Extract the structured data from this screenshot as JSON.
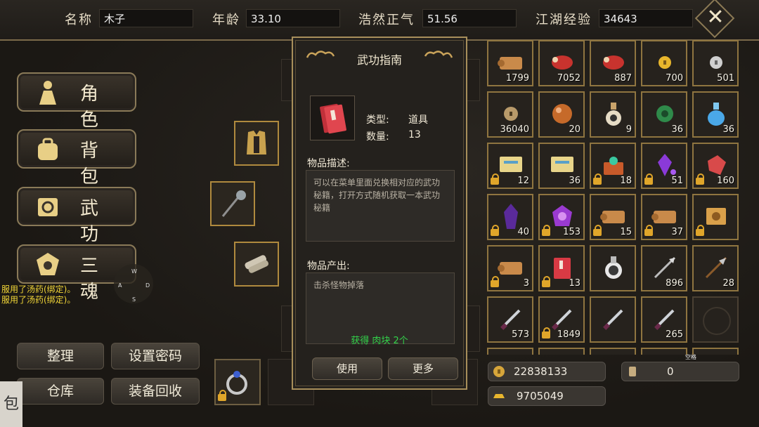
{
  "header": {
    "name_label": "名称",
    "name_value": "木子",
    "age_label": "年龄",
    "age_value": "33.10",
    "righteous_label": "浩然正气",
    "righteous_value": "51.56",
    "exp_label": "江湖经验",
    "exp_value": "34643",
    "close_icon": "close-icon"
  },
  "menu": [
    {
      "label": "角色",
      "icon": "character-icon"
    },
    {
      "label": "背包",
      "icon": "backpack-icon"
    },
    {
      "label": "武功",
      "icon": "martial-arts-icon"
    },
    {
      "label": "三魂",
      "icon": "soul-icon"
    }
  ],
  "log": [
    "服用了汤药(绑定)。",
    "服用了汤药(绑定)。"
  ],
  "compass": {
    "w": "W",
    "a": "A",
    "s": "S",
    "d": "D"
  },
  "bottom_buttons": {
    "sort": "整理",
    "set_password": "设置密码",
    "warehouse": "仓库",
    "recycle": "装备回收"
  },
  "bag_tab": "包",
  "dialog": {
    "title": "武功指南",
    "type_label": "类型:",
    "type_value": "道具",
    "qty_label": "数量:",
    "qty_value": "13",
    "desc_label": "物品描述:",
    "desc_text": "可以在菜单里面兑换相对应的武功秘籍，打开方式随机获取一本武功秘籍",
    "source_label": "物品产出:",
    "source_text": "击杀怪物掉落",
    "obtain_text": "获得 肉块 2个",
    "use_button": "使用",
    "more_button": "更多"
  },
  "inventory": [
    {
      "count": "1799",
      "icon": "scroll-icon",
      "locked": false
    },
    {
      "count": "7052",
      "icon": "meat-icon",
      "locked": false
    },
    {
      "count": "887",
      "icon": "meat-icon",
      "locked": false
    },
    {
      "count": "700",
      "icon": "gold-coin-icon",
      "locked": false
    },
    {
      "count": "501",
      "icon": "silver-coin-icon",
      "locked": false
    },
    {
      "count": "36040",
      "icon": "copper-coin-icon",
      "locked": false
    },
    {
      "count": "20",
      "icon": "orb-icon",
      "locked": false
    },
    {
      "count": "9",
      "icon": "vase-icon",
      "locked": false
    },
    {
      "count": "36",
      "icon": "jade-icon",
      "locked": false
    },
    {
      "count": "36",
      "icon": "potion-icon",
      "locked": false
    },
    {
      "count": "12",
      "icon": "ticket-icon",
      "locked": true
    },
    {
      "count": "36",
      "icon": "ticket-icon",
      "locked": false
    },
    {
      "count": "18",
      "icon": "chest-icon",
      "locked": true
    },
    {
      "count": "51",
      "icon": "gem-icon",
      "locked": true
    },
    {
      "count": "160",
      "icon": "ruby-icon",
      "locked": true
    },
    {
      "count": "40",
      "icon": "crystal-icon",
      "locked": true
    },
    {
      "count": "153",
      "icon": "amethyst-icon",
      "locked": true
    },
    {
      "count": "15",
      "icon": "scroll-icon",
      "locked": true
    },
    {
      "count": "37",
      "icon": "scroll-icon",
      "locked": true
    },
    {
      "count": "",
      "icon": "map-scroll-icon",
      "locked": true
    },
    {
      "count": "3",
      "icon": "scroll-icon",
      "locked": true
    },
    {
      "count": "13",
      "icon": "book-icon",
      "locked": true
    },
    {
      "count": "",
      "icon": "flask-icon",
      "locked": false
    },
    {
      "count": "896",
      "icon": "arrow-icon",
      "locked": false
    },
    {
      "count": "28",
      "icon": "spear-icon",
      "locked": false
    },
    {
      "count": "573",
      "icon": "dagger-icon",
      "locked": false
    },
    {
      "count": "1849",
      "icon": "dagger-icon",
      "locked": true
    },
    {
      "count": "",
      "icon": "dagger-icon",
      "locked": false
    },
    {
      "count": "265",
      "icon": "dagger-icon",
      "locked": false
    },
    {
      "count": "",
      "icon": "empty-slot-icon",
      "locked": false
    }
  ],
  "empty_label": "空格",
  "currency": {
    "copper": "22838133",
    "gold": "9705049",
    "other": "0"
  },
  "colors": {
    "accent": "#b08a3e",
    "green": "#32d34a",
    "log_yellow": "#f2d637"
  }
}
